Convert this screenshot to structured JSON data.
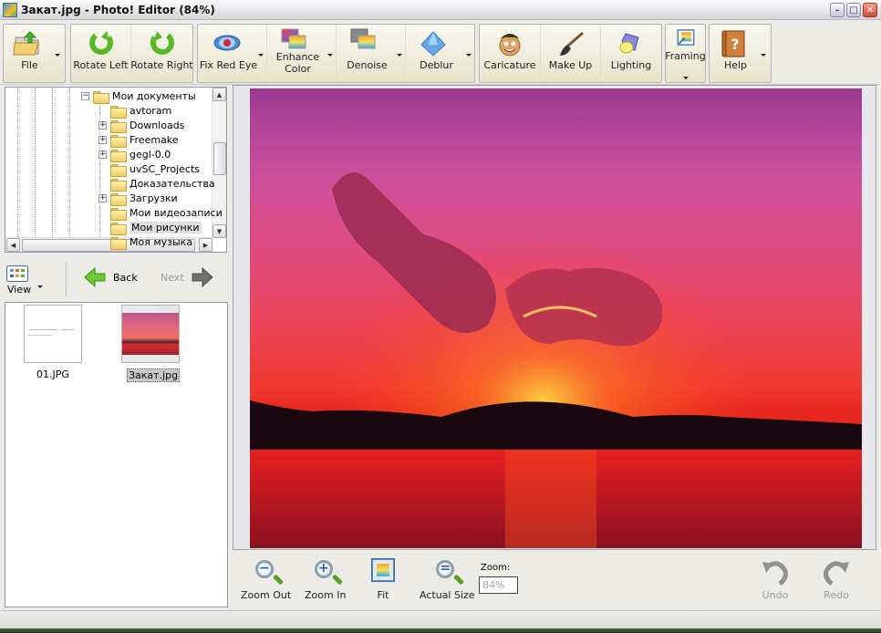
{
  "window": {
    "title": "Закат.jpg - Photo! Editor (84%)",
    "controls": [
      "minimize",
      "maximize",
      "close"
    ]
  },
  "toolbar": {
    "groups": [
      {
        "buttons": [
          {
            "label": "File",
            "icon": "open-folder-icon",
            "has_dropdown": true
          }
        ]
      },
      {
        "buttons": [
          {
            "label": "Rotate Left",
            "icon": "rotate-left-icon"
          },
          {
            "label": "Rotate Right",
            "icon": "rotate-right-icon"
          }
        ]
      },
      {
        "buttons": [
          {
            "label": "Fix Red Eye",
            "icon": "eye-icon",
            "has_dropdown": true
          },
          {
            "label_line1": "Enhance",
            "label_line2": "Color",
            "icon": "enhance-color-icon",
            "has_dropdown": true
          },
          {
            "label": "Denoise",
            "icon": "denoise-icon",
            "has_dropdown": true
          },
          {
            "label": "Deblur",
            "icon": "diamond-icon",
            "has_dropdown": true
          }
        ]
      },
      {
        "buttons": [
          {
            "label": "Caricature",
            "icon": "caricature-face-icon"
          },
          {
            "label": "Make Up",
            "icon": "makeup-brush-icon"
          },
          {
            "label": "Lighting",
            "icon": "lamp-icon"
          }
        ]
      },
      {
        "buttons": [
          {
            "label": "Framing",
            "icon": "framing-icon",
            "has_dropdown": true
          }
        ]
      },
      {
        "buttons": [
          {
            "label": "Help",
            "icon": "help-book-icon",
            "has_dropdown": true
          }
        ]
      }
    ]
  },
  "tree": {
    "items": [
      {
        "label": "Мои документы",
        "expander": "−",
        "level": 0,
        "icon": "folder-icon"
      },
      {
        "label": "avtoram",
        "expander": "",
        "level": 1,
        "icon": "folder-icon"
      },
      {
        "label": "Downloads",
        "expander": "+",
        "level": 1,
        "icon": "folder-icon"
      },
      {
        "label": "Freemake",
        "expander": "+",
        "level": 1,
        "icon": "folder-icon"
      },
      {
        "label": "gegl-0.0",
        "expander": "+",
        "level": 1,
        "icon": "folder-icon"
      },
      {
        "label": "uvSC_Projects",
        "expander": "",
        "level": 1,
        "icon": "folder-icon"
      },
      {
        "label": "Доказательства",
        "expander": "",
        "level": 1,
        "icon": "folder-icon"
      },
      {
        "label": "Загрузки",
        "expander": "+",
        "level": 1,
        "icon": "folder-icon"
      },
      {
        "label": "Мои видеозаписи",
        "expander": "",
        "level": 1,
        "icon": "video-folder-icon"
      },
      {
        "label": "Мои рисунки",
        "expander": "",
        "level": 1,
        "icon": "pictures-folder-icon",
        "selected": true
      },
      {
        "label": "Моя музыка",
        "expander": "",
        "level": 1,
        "icon": "music-folder-icon"
      }
    ]
  },
  "nav": {
    "view_label": "View",
    "back_label": "Back",
    "next_label": "Next",
    "next_enabled": false
  },
  "thumbnails": [
    {
      "name": "01.JPG",
      "selected": false
    },
    {
      "name": "Закат.jpg",
      "selected": true
    }
  ],
  "bottom": {
    "zoom_out": "Zoom Out",
    "zoom_in": "Zoom In",
    "fit": "Fit",
    "actual_size": "Actual Size",
    "zoom_label": "Zoom:",
    "zoom_value": "84%",
    "undo": "Undo",
    "redo": "Redo",
    "undo_enabled": false,
    "redo_enabled": false
  }
}
